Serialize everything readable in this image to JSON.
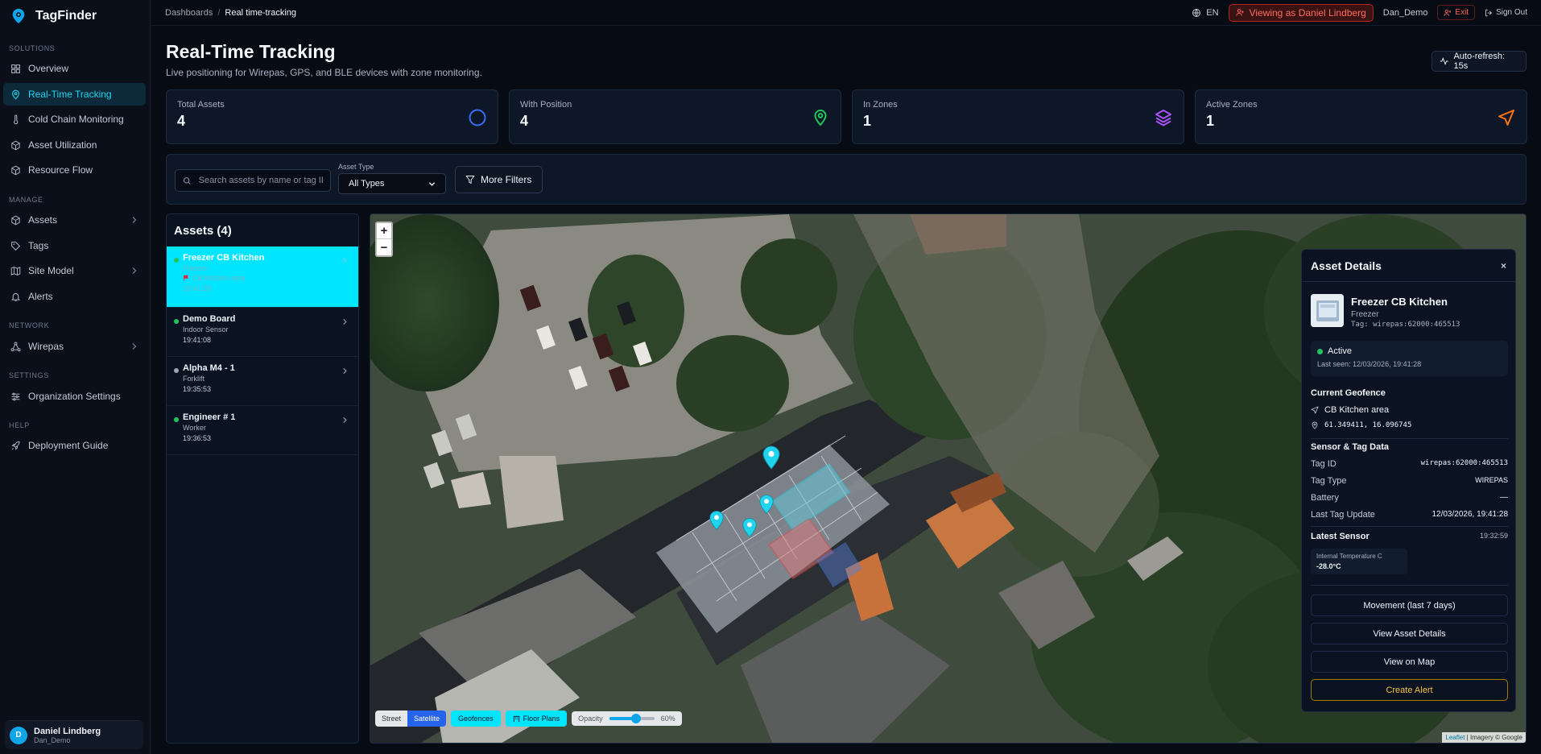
{
  "app": {
    "name": "TagFinder"
  },
  "sidebar": {
    "sections": {
      "solutions": "SOLUTIONS",
      "manage": "MANAGE",
      "network": "NETWORK",
      "settings": "SETTINGS",
      "help": "HELP"
    },
    "items": [
      {
        "label": "Overview",
        "icon": "grid-icon"
      },
      {
        "label": "Real-Time Tracking",
        "icon": "pin-icon"
      },
      {
        "label": "Cold Chain Monitoring",
        "icon": "thermometer-icon"
      },
      {
        "label": "Asset Utilization",
        "icon": "box-icon"
      },
      {
        "label": "Resource Flow",
        "icon": "box-icon"
      },
      {
        "label": "Assets",
        "icon": "box-icon"
      },
      {
        "label": "Tags",
        "icon": "tag-icon"
      },
      {
        "label": "Site Model",
        "icon": "map-icon"
      },
      {
        "label": "Alerts",
        "icon": "bell-icon"
      },
      {
        "label": "Wirepas",
        "icon": "network-icon"
      },
      {
        "label": "Organization Settings",
        "icon": "sliders-icon"
      },
      {
        "label": "Deployment Guide",
        "icon": "rocket-icon"
      }
    ],
    "user": {
      "initial": "D",
      "name": "Daniel Lindberg",
      "handle": "Dan_Demo"
    }
  },
  "topbar": {
    "breadcrumb": [
      "Dashboards",
      "/",
      "Real time-tracking"
    ],
    "language": "EN",
    "viewing_as": "Viewing as Daniel Lindberg",
    "username": "Dan_Demo",
    "exit": "Exit",
    "sign_out": "Sign Out"
  },
  "header": {
    "title": "Real-Time Tracking",
    "subtitle": "Live positioning for Wirepas, GPS, and BLE devices with zone monitoring.",
    "auto_refresh": "Auto-refresh: 15s"
  },
  "stats": [
    {
      "label": "Total Assets",
      "value": "4",
      "icon": "circle-icon",
      "color": "#3b6cf6"
    },
    {
      "label": "With Position",
      "value": "4",
      "icon": "location-pin-icon",
      "color": "#22c55e"
    },
    {
      "label": "In Zones",
      "value": "1",
      "icon": "layers-icon",
      "color": "#a855f7"
    },
    {
      "label": "Active Zones",
      "value": "1",
      "icon": "navigation-icon",
      "color": "#f97316"
    }
  ],
  "filters": {
    "search_placeholder": "Search assets by name or tag ID",
    "asset_type_label": "Asset Type",
    "asset_type_value": "All Types",
    "more_filters": "More Filters"
  },
  "assets": {
    "title": "Assets (4)",
    "items": [
      {
        "name": "Freezer CB Kitchen",
        "type": "Freezer",
        "zone": "CB Kitchen area",
        "time": "19:41:28",
        "status_color": "#22c55e"
      },
      {
        "name": "Demo Board",
        "type": "Indoor Sensor",
        "zone": "",
        "time": "19:41:08",
        "status_color": "#22c55e"
      },
      {
        "name": "Alpha M4 - 1",
        "type": "Forklift",
        "zone": "",
        "time": "19:35:53",
        "status_color": "#9aa6b8"
      },
      {
        "name": "Engineer # 1",
        "type": "Worker",
        "zone": "",
        "time": "19:36:53",
        "status_color": "#22c55e"
      }
    ]
  },
  "map": {
    "zoom_in": "+",
    "zoom_out": "−",
    "street": "Street",
    "satellite": "Satellite",
    "geofences": "Geofences",
    "floor_plans": "Floor Plans",
    "opacity_label": "Opacity",
    "opacity_value": "60%",
    "opacity_fraction": 0.6,
    "attribution_link": "Leaflet",
    "attribution_text": " | Imagery © Google"
  },
  "details": {
    "title": "Asset Details",
    "close": "×",
    "name": "Freezer CB Kitchen",
    "type": "Freezer",
    "tag": "Tag: wirepas:62000:465513",
    "status": "Active",
    "last_seen": "Last seen: 12/03/2026, 19:41:28",
    "geofence_heading": "Current Geofence",
    "geofence": "CB Kitchen area",
    "coords": "61.349411, 16.096745",
    "sensor_heading": "Sensor & Tag Data",
    "rows": [
      {
        "k": "Tag ID",
        "v": "wirepas:62000:465513"
      },
      {
        "k": "Tag Type",
        "v": "WIREPAS"
      },
      {
        "k": "Battery",
        "v": "—"
      },
      {
        "k": "Last Tag Update",
        "v": "12/03/2026, 19:41:28"
      }
    ],
    "latest_sensor": "Latest Sensor",
    "latest_sensor_time": "19:32:59",
    "sensor_label": "Internal Temperature C",
    "sensor_value": "-28.0°C",
    "buttons": {
      "movement": "Movement (last 7 days)",
      "view_details": "View Asset Details",
      "view_map": "View on Map",
      "create_alert": "Create Alert"
    }
  }
}
